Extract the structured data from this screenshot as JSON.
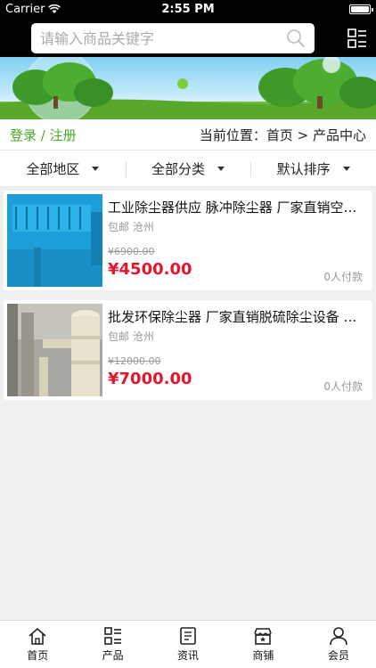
{
  "status_bar": {
    "carrier": "Carrier",
    "time": "2:55 PM"
  },
  "search": {
    "placeholder": "请输入商品关键字"
  },
  "login_bar": {
    "login": "登录",
    "separator": " / ",
    "register": "注册",
    "location": "当前位置：首页 > 产品中心"
  },
  "filters": [
    {
      "label": "全部地区"
    },
    {
      "label": "全部分类"
    },
    {
      "label": "默认排序"
    }
  ],
  "products": [
    {
      "title": "工业除尘器供应 脉冲除尘器 厂家直销空气净化设备",
      "shipping": "包邮",
      "city": "沧州",
      "old_price": "¥6900.00",
      "price": "¥4500.00",
      "paid": "0人付款"
    },
    {
      "title": "批发环保除尘器 厂家直销脱硫除尘设备 质量保证",
      "shipping": "包邮",
      "city": "沧州",
      "old_price": "¥12000.00",
      "price": "¥7000.00",
      "paid": "0人付款"
    }
  ],
  "tabs": [
    {
      "label": "首页",
      "icon": "home-icon"
    },
    {
      "label": "产品",
      "icon": "list-icon"
    },
    {
      "label": "资讯",
      "icon": "news-icon"
    },
    {
      "label": "商铺",
      "icon": "shop-icon"
    },
    {
      "label": "会员",
      "icon": "user-icon"
    }
  ],
  "colors": {
    "accent_green": "#4caa2a",
    "price_red": "#e5162b",
    "header": "#000000"
  }
}
